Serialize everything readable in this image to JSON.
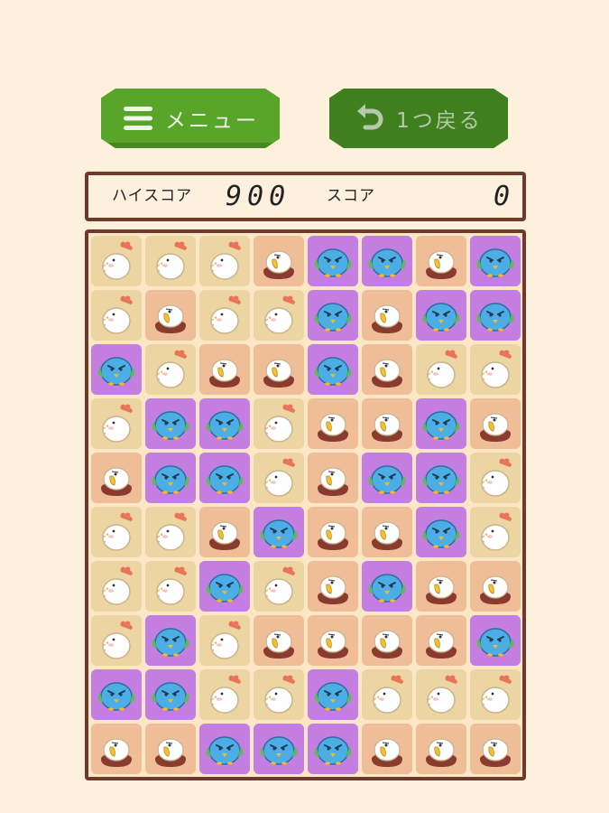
{
  "toolbar": {
    "menu_label": "メニュー",
    "undo_label": "1つ戻る",
    "menu_icon": "hamburger-icon",
    "undo_icon": "undo-arrow-icon"
  },
  "score": {
    "high_label": "ハイスコア",
    "high_value": "900",
    "label": "スコア",
    "value": "0"
  },
  "board": {
    "columns": 8,
    "rows": 10,
    "pieces": {
      "C": {
        "name": "chicken",
        "tile_color": "#ecd5a3"
      },
      "E": {
        "name": "eagle",
        "tile_color": "#efbe98"
      },
      "P": {
        "name": "penguin",
        "tile_color": "#c47de0"
      }
    },
    "grid": [
      [
        "C",
        "C",
        "C",
        "E",
        "P",
        "P",
        "E",
        "P"
      ],
      [
        "C",
        "E",
        "C",
        "C",
        "P",
        "E",
        "P",
        "P"
      ],
      [
        "P",
        "C",
        "E",
        "E",
        "P",
        "E",
        "C",
        "C"
      ],
      [
        "C",
        "P",
        "P",
        "C",
        "E",
        "E",
        "P",
        "E"
      ],
      [
        "E",
        "P",
        "P",
        "C",
        "E",
        "P",
        "P",
        "C"
      ],
      [
        "C",
        "C",
        "E",
        "P",
        "E",
        "E",
        "P",
        "C"
      ],
      [
        "C",
        "C",
        "P",
        "C",
        "E",
        "P",
        "E",
        "E"
      ],
      [
        "C",
        "P",
        "C",
        "E",
        "E",
        "E",
        "E",
        "P"
      ],
      [
        "P",
        "P",
        "C",
        "C",
        "P",
        "C",
        "C",
        "C"
      ],
      [
        "E",
        "E",
        "P",
        "P",
        "P",
        "E",
        "E",
        "E"
      ]
    ]
  }
}
